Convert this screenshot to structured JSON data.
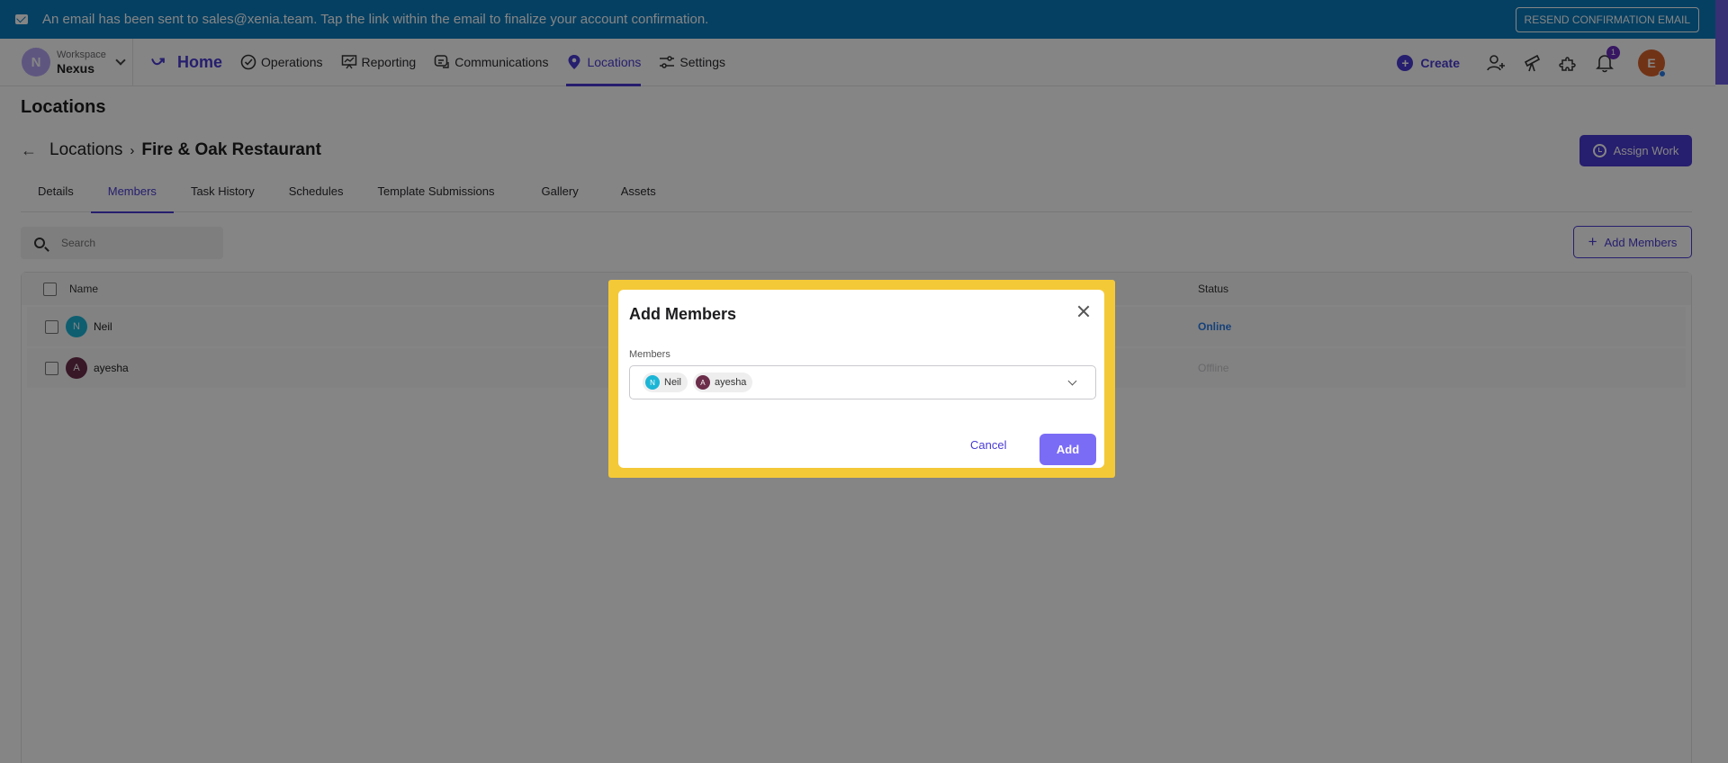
{
  "banner": {
    "message": "An email has been sent to sales@xenia.team. Tap the link within the email to finalize your account confirmation.",
    "resend_label": "RESEND CONFIRMATION EMAIL"
  },
  "workspace": {
    "label": "Workspace",
    "name": "Nexus",
    "initial": "N"
  },
  "nav": {
    "home": "Home",
    "items": [
      "Operations",
      "Reporting",
      "Communications",
      "Locations",
      "Settings"
    ],
    "active": "Locations",
    "create_label": "Create",
    "notification_count": "1",
    "user_initial": "E"
  },
  "page": {
    "title": "Locations",
    "breadcrumb_parent": "Locations",
    "breadcrumb_current": "Fire & Oak Restaurant",
    "assign_work": "Assign Work",
    "tabs": [
      "Details",
      "Members",
      "Task History",
      "Schedules",
      "Template Submissions",
      "Gallery",
      "Assets"
    ],
    "active_tab": "Members",
    "search_placeholder": "Search",
    "add_members": "Add Members"
  },
  "table": {
    "headers": {
      "name": "Name",
      "status": "Status"
    },
    "rows": [
      {
        "initial": "N",
        "name": "Neil",
        "status": "Online",
        "color": "#1cb5d6"
      },
      {
        "initial": "A",
        "name": "ayesha",
        "status": "Offline",
        "color": "#6b2d4a"
      }
    ]
  },
  "modal": {
    "title": "Add Members",
    "field_label": "Members",
    "chips": [
      {
        "initial": "N",
        "name": "Neil",
        "color": "#1cb5d6"
      },
      {
        "initial": "A",
        "name": "ayesha",
        "color": "#6b2d4a"
      }
    ],
    "cancel": "Cancel",
    "add": "Add"
  },
  "colors": {
    "accent": "#4a3bd4",
    "banner": "#0b7bbd",
    "highlight": "#f4c938"
  }
}
